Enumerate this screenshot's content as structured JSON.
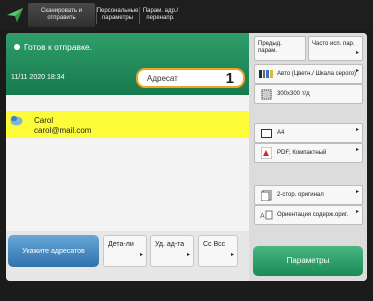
{
  "topbar": {
    "tabs": [
      {
        "label": "Сканировать и отправить"
      },
      {
        "label": "Персональные параметры"
      },
      {
        "label": "Парам. адр./перенапр."
      }
    ]
  },
  "status": {
    "text": "Готов к отправке.",
    "datetime": "11/11 2020 18:34"
  },
  "addressee": {
    "label": "Адресат",
    "count": "1"
  },
  "destination": {
    "name": "Carol",
    "email": "carol@mail.com"
  },
  "bottom_buttons": {
    "specify": "Укажите адресатов",
    "details": "Дета-ли",
    "delete": "Уд. ад-та",
    "cc": "Cc Bcc"
  },
  "right": {
    "top_buttons": {
      "prev": "Предыд. парам.",
      "frequent": "Часто исп. пар."
    },
    "settings": {
      "color": "Авто (Цветн./ Шкала серого)",
      "resolution": "300x300 т/д",
      "size": "A4",
      "format": "PDF; Компактный",
      "duplex": "2-стор. оригинал",
      "orientation": "Ориентация содерж.ориг."
    },
    "options": "Параметры"
  },
  "colors": {
    "status_green": "#1f8a58",
    "addressee_border": "#f3a31e",
    "selected_row": "#fcfc3a",
    "specify_blue": "#3b7fbb",
    "options_green": "#1b8a55"
  }
}
